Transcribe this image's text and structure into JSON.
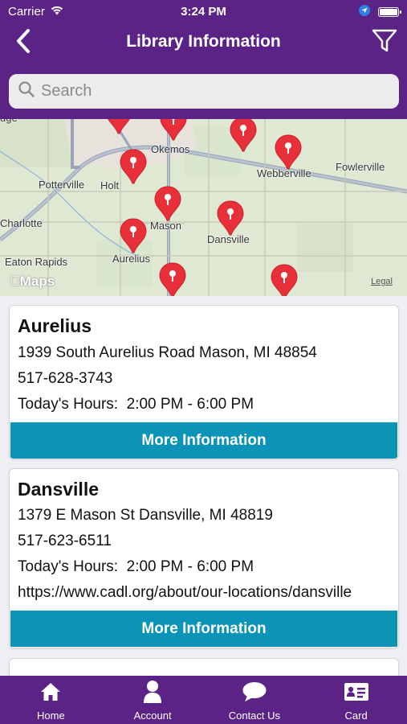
{
  "status_bar": {
    "carrier": "Carrier",
    "time": "3:24 PM"
  },
  "nav": {
    "title": "Library Information"
  },
  "search": {
    "placeholder": "Search"
  },
  "map": {
    "cities": {
      "okemos": "Okemos",
      "webberville": "Webberville",
      "fowlerville": "Fowlerville",
      "potterville": "Potterville",
      "holt": "Holt",
      "charlotte": "Charlotte",
      "mason": "Mason",
      "dansville": "Dansville",
      "eaton_rapids": "Eaton Rapids",
      "aurelius": "Aurelius"
    },
    "attribution": "Maps",
    "legal": "Legal",
    "pin_color": "#e8303a"
  },
  "libraries": [
    {
      "name": "Aurelius",
      "address": "1939 South Aurelius Road Mason, MI 48854",
      "phone": "517-628-3743",
      "hours": "Today's Hours:  2:00 PM - 6:00 PM",
      "button": "More Information"
    },
    {
      "name": "Dansville",
      "address": "1379 E Mason St Dansville, MI 48819",
      "phone": "517-623-6511",
      "hours": "Today's Hours:  2:00 PM - 6:00 PM",
      "website": "https://www.cadl.org/about/our-locations/dansville",
      "button": "More Information"
    }
  ],
  "tabbar": {
    "home": "Home",
    "account": "Account",
    "contact": "Contact Us",
    "card": "Card"
  },
  "colors": {
    "brand_purple": "#5b2386",
    "button_teal": "#0b93b8"
  }
}
